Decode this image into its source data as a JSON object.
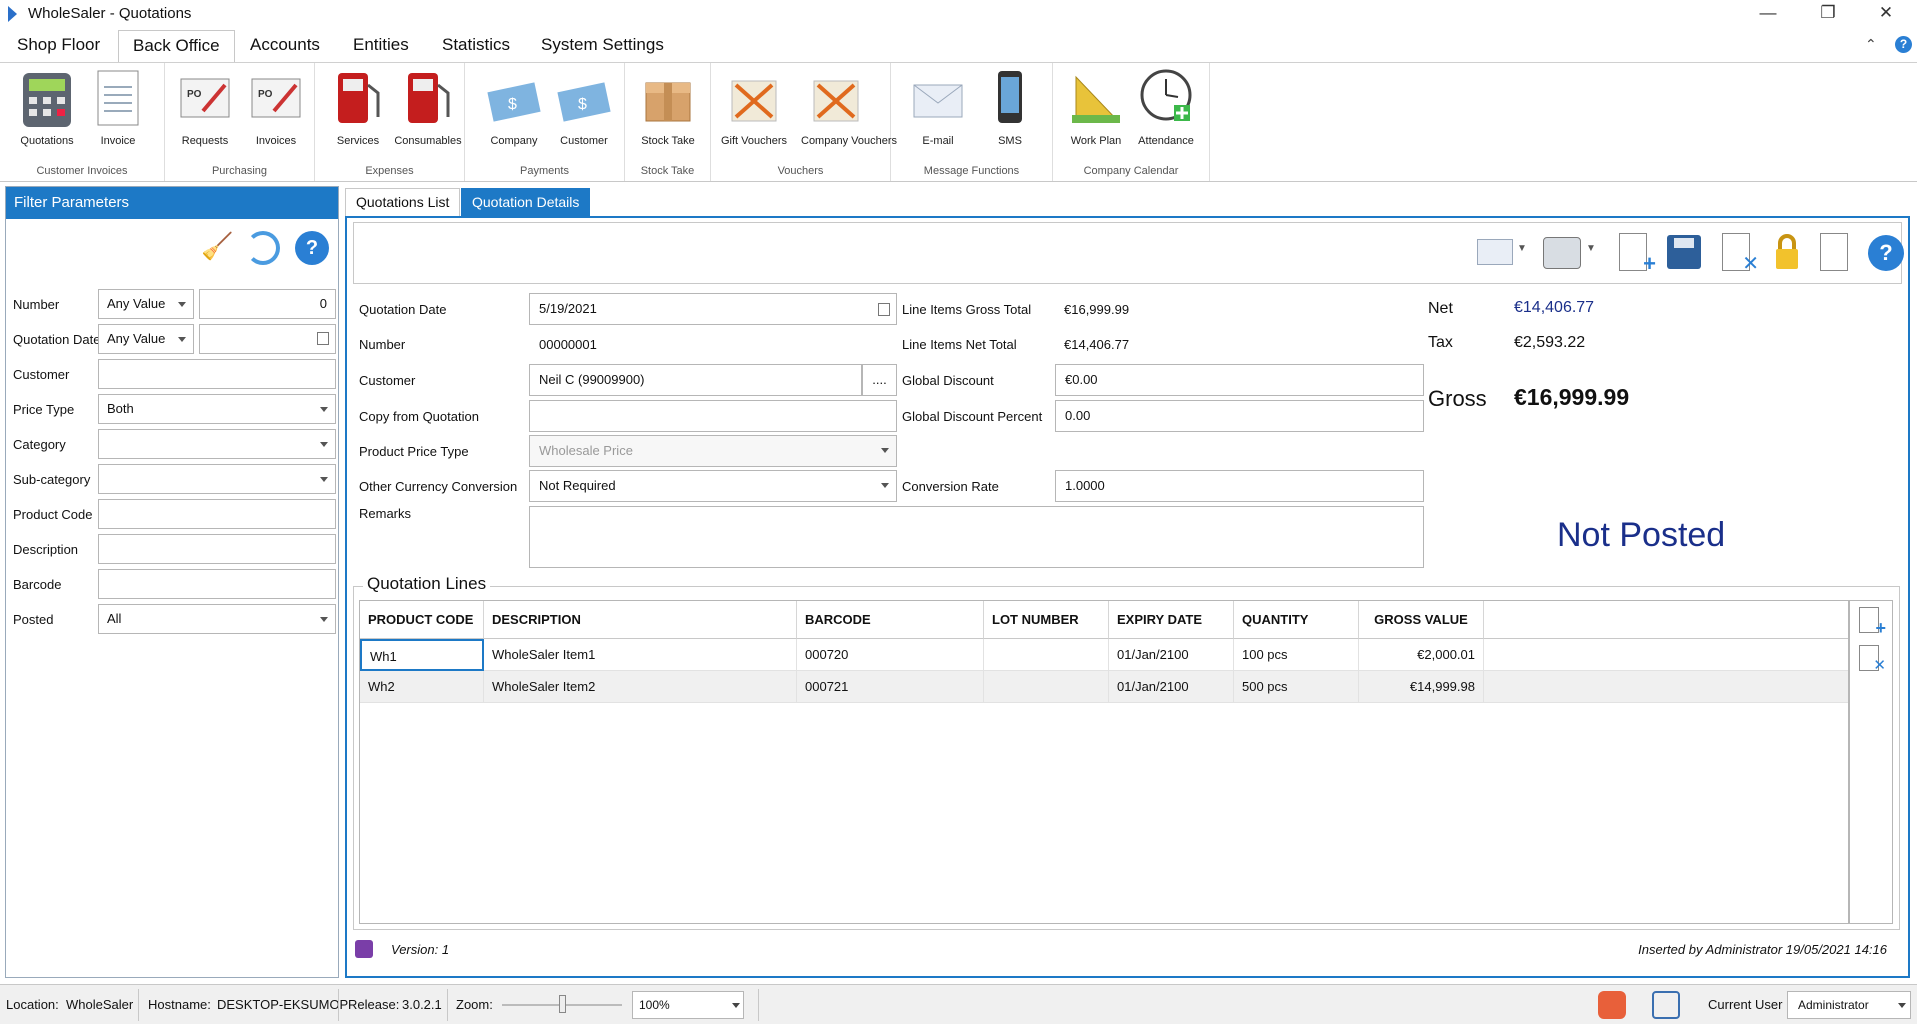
{
  "window": {
    "title": "WholeSaler - Quotations",
    "minimize": "—",
    "restore": "❐",
    "close": "✕"
  },
  "menu": {
    "tabs": [
      "Shop Floor",
      "Back Office",
      "Accounts",
      "Entities",
      "Statistics",
      "System Settings"
    ],
    "active": "Back Office"
  },
  "ribbon": {
    "groups": [
      {
        "name": "Customer Invoices",
        "buttons": [
          "Quotations",
          "Invoice"
        ]
      },
      {
        "name": "Purchasing",
        "buttons": [
          "Requests",
          "Invoices"
        ]
      },
      {
        "name": "Expenses",
        "buttons": [
          "Services",
          "Consumables"
        ]
      },
      {
        "name": "Payments",
        "buttons": [
          "Company",
          "Customer"
        ]
      },
      {
        "name": "Stock Take",
        "buttons": [
          "Stock Take"
        ]
      },
      {
        "name": "Vouchers",
        "buttons": [
          "Gift Vouchers",
          "Company Vouchers"
        ]
      },
      {
        "name": "Message Functions",
        "buttons": [
          "E-mail",
          "SMS"
        ]
      },
      {
        "name": "Company Calendar",
        "buttons": [
          "Work Plan",
          "Attendance"
        ]
      }
    ]
  },
  "filter": {
    "title": "Filter Parameters",
    "number": {
      "label": "Number",
      "op": "Any Value",
      "value": "0"
    },
    "quotation_date": {
      "label": "Quotation Date",
      "op": "Any Value",
      "value": ""
    },
    "customer": {
      "label": "Customer",
      "value": ""
    },
    "price_type": {
      "label": "Price Type",
      "value": "Both"
    },
    "category": {
      "label": "Category",
      "value": ""
    },
    "sub_category": {
      "label": "Sub-category",
      "value": ""
    },
    "product_code": {
      "label": "Product Code",
      "value": ""
    },
    "description": {
      "label": "Description",
      "value": ""
    },
    "barcode": {
      "label": "Barcode",
      "value": ""
    },
    "posted": {
      "label": "Posted",
      "value": "All"
    }
  },
  "tabs": {
    "list": "Quotations List",
    "details": "Quotation Details"
  },
  "form": {
    "quotation_date": {
      "label": "Quotation Date",
      "value": "5/19/2021"
    },
    "number": {
      "label": "Number",
      "value": "00000001"
    },
    "customer": {
      "label": "Customer",
      "value": "Neil C (99009900)",
      "button": "...."
    },
    "copy_from": {
      "label": "Copy from Quotation",
      "value": ""
    },
    "price_type": {
      "label": "Product Price Type",
      "value": "Wholesale Price"
    },
    "currency_conv": {
      "label": "Other Currency Conversion",
      "value": "Not Required"
    },
    "remarks": {
      "label": "Remarks",
      "value": ""
    },
    "gross_total": {
      "label": "Line Items Gross Total",
      "value": "€16,999.99"
    },
    "net_total": {
      "label": "Line Items Net Total",
      "value": "€14,406.77"
    },
    "global_discount": {
      "label": "Global Discount",
      "value": "€0.00"
    },
    "global_discount_pct": {
      "label": "Global Discount Percent",
      "value": "0.00"
    },
    "conversion_rate": {
      "label": "Conversion Rate",
      "value": "1.0000"
    }
  },
  "summary": {
    "net_label": "Net",
    "net": "€14,406.77",
    "tax_label": "Tax",
    "tax": "€2,593.22",
    "gross_label": "Gross",
    "gross": "€16,999.99",
    "status": "Not Posted"
  },
  "lines": {
    "title": "Quotation Lines",
    "columns": [
      "PRODUCT CODE",
      "DESCRIPTION",
      "BARCODE",
      "LOT NUMBER",
      "EXPIRY DATE",
      "QUANTITY",
      "GROSS VALUE"
    ],
    "rows": [
      [
        "Wh1",
        "WholeSaler Item1",
        "000720",
        "",
        "01/Jan/2100",
        "100 pcs",
        "€2,000.01"
      ],
      [
        "Wh2",
        "WholeSaler Item2",
        "000721",
        "",
        "01/Jan/2100",
        "500 pcs",
        "€14,999.98"
      ]
    ]
  },
  "footer": {
    "version": "Version:  1",
    "inserted": "Inserted by Administrator 19/05/2021 14:16"
  },
  "status": {
    "location_label": "Location:",
    "location": "WholeSaler",
    "hostname_label": "Hostname:",
    "hostname": "DESKTOP-EKSUMOP",
    "release_label": "Release:",
    "release": "3.0.2.1",
    "zoom_label": "Zoom:",
    "zoom": "100%",
    "zoom_level": 0.5,
    "user_label": "Current User",
    "user": "Administrator"
  },
  "colors": {
    "accent": "#1d79c6",
    "status_text": "#1a2f8a"
  }
}
